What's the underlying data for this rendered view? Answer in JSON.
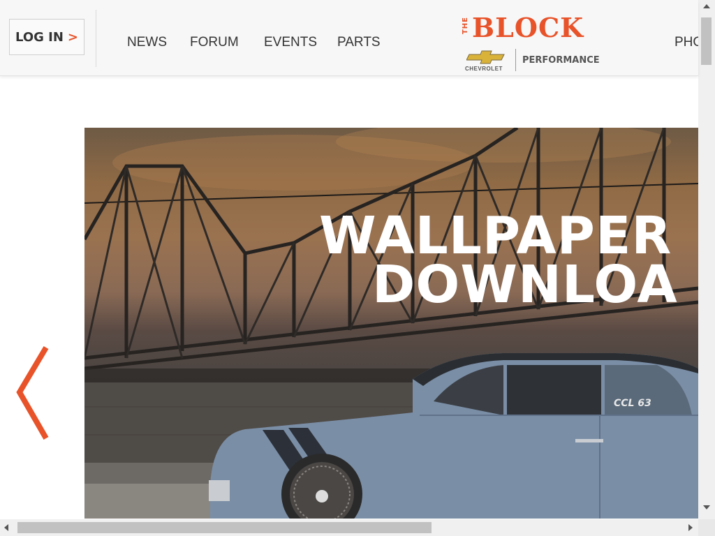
{
  "header": {
    "login_label": "LOG IN",
    "login_chevron": ">",
    "nav": [
      "NEWS",
      "FORUM",
      "EVENTS",
      "PARTS",
      "PHO"
    ],
    "logo": {
      "the": "THE",
      "block": "BLOCK",
      "brand": "CHEVROLET",
      "tagline": "PERFORMANCE"
    }
  },
  "hero": {
    "title_line1": "WALLPAPER",
    "title_line2": "DOWNLOA",
    "plate_text": "CCL 63"
  },
  "colors": {
    "accent": "#e8532a",
    "header_bg": "#f7f7f7",
    "car_body": "#7a8ea6"
  },
  "icons": {
    "prev": "chevron-left-icon",
    "login": "chevron-right-icon"
  }
}
